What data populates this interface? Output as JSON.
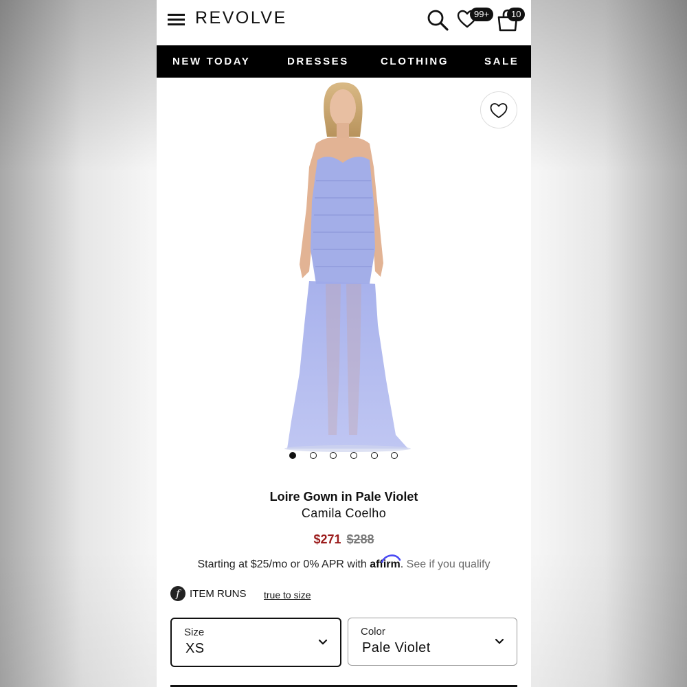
{
  "header": {
    "logo": "REVOLVE",
    "wishlist_badge": "99+",
    "cart_badge": "10"
  },
  "nav": {
    "items": [
      "NEW TODAY",
      "DRESSES",
      "CLOTHING",
      "SALE"
    ]
  },
  "product": {
    "title": "Loire Gown in Pale Violet",
    "brand": "Camila Coelho",
    "sale_price": "$271",
    "original_price": "$288",
    "gallery_count": 6,
    "gallery_active": 1,
    "dress_color": "#a7b1ec"
  },
  "financing": {
    "prefix": "Starting at $25/mo or 0% APR with",
    "logo": "affirm",
    "suffix": ".",
    "link": "See if you qualify"
  },
  "fit": {
    "icon": "f",
    "label": "ITEM RUNS",
    "value": "true to size"
  },
  "selectors": {
    "size": {
      "label": "Size",
      "value": "XS"
    },
    "color": {
      "label": "Color",
      "value": "Pale Violet"
    }
  }
}
